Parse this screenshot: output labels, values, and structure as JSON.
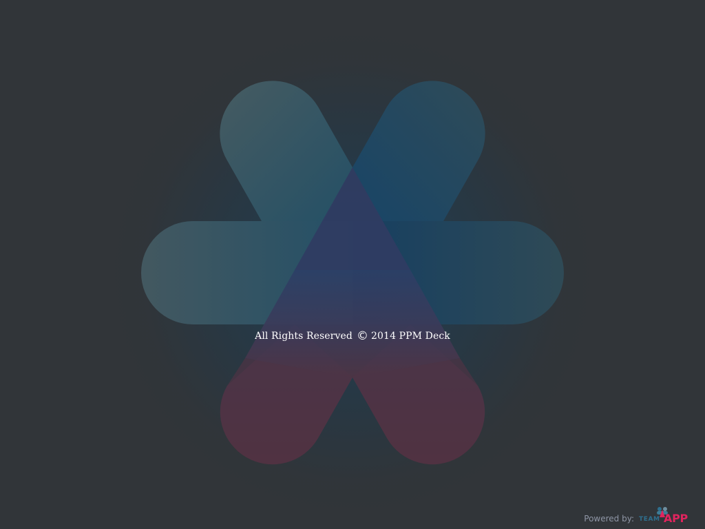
{
  "footer": {
    "copyright_prefix": "All Rights Reserved",
    "copyright_symbol": "©",
    "copyright_suffix": "2014 PPM Deck"
  },
  "powered_by": {
    "label": "Powered by:",
    "brand_team": "TEAM",
    "brand_app": "APP"
  },
  "colors": {
    "background": "#313539",
    "logo_gray_top": "#445960",
    "logo_blue": "#1d5070",
    "logo_purple": "#343d63",
    "logo_red": "#552f3d",
    "brand_red": "#e0245e",
    "brand_blue": "#2e6f8e"
  }
}
